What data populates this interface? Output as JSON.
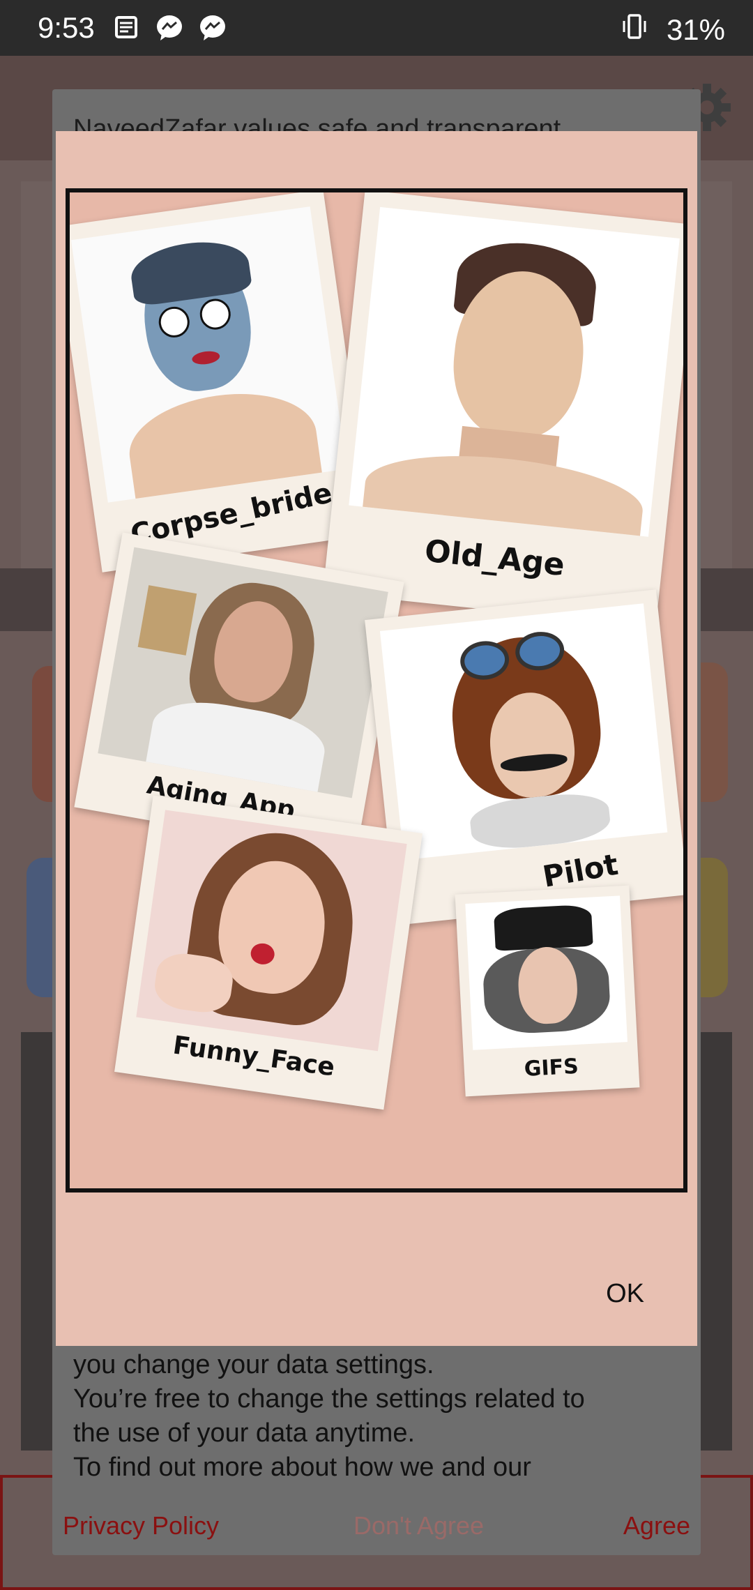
{
  "status_bar": {
    "time": "9:53",
    "battery": "31%",
    "icons": [
      "news-icon",
      "messenger-icon",
      "messenger-icon",
      "vibrate-icon"
    ]
  },
  "consent": {
    "title": "NaveedZafar values safe and transparent",
    "body_lines": [
      "you change your data settings.",
      "You’re free to change the settings related to",
      "the use of your data anytime.",
      "To find out more about how we and our"
    ],
    "privacy_label": "Privacy Policy",
    "disagree_label": "Don't Agree",
    "agree_label": "Agree"
  },
  "promo": {
    "cards": {
      "corpse": "Corpse_bride",
      "old_age": "Old_Age",
      "aging": "Aging_App",
      "pilot": "Pilot",
      "funny": "Funny_Face",
      "gifs": "GIFS"
    },
    "ok_label": "OK"
  }
}
